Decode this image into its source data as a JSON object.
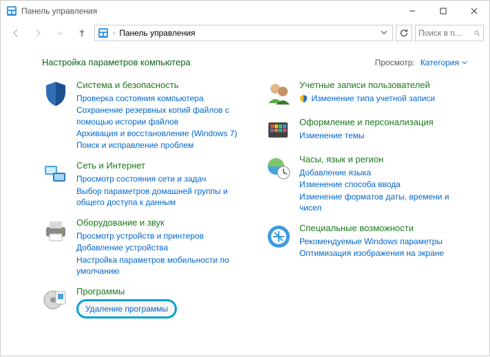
{
  "window": {
    "title": "Панель управления"
  },
  "nav": {
    "breadcrumb": "Панель управления",
    "search_placeholder": "Поиск в п..."
  },
  "header": {
    "page_title": "Настройка параметров компьютера",
    "view_label": "Просмотр:",
    "view_value": "Категория"
  },
  "left": [
    {
      "title": "Система и безопасность",
      "links": [
        "Проверка состояния компьютера",
        "Сохранение резервных копий файлов с помощью истории файлов",
        "Архивация и восстановление (Windows 7)",
        "Поиск и исправление проблем"
      ]
    },
    {
      "title": "Сеть и Интернет",
      "links": [
        "Просмотр состояния сети и задач",
        "Выбор параметров домашней группы и общего доступа к данным"
      ]
    },
    {
      "title": "Оборудование и звук",
      "links": [
        "Просмотр устройств и принтеров",
        "Добавление устройства",
        "Настройка параметров мобильности по умолчанию"
      ]
    },
    {
      "title": "Программы",
      "links": [
        "Удаление программы"
      ]
    }
  ],
  "right": [
    {
      "title": "Учетные записи пользователей",
      "links": [
        "Изменение типа учетной записи"
      ],
      "shield": [
        true
      ]
    },
    {
      "title": "Оформление и персонализация",
      "links": [
        "Изменение темы"
      ]
    },
    {
      "title": "Часы, язык и регион",
      "links": [
        "Добавление языка",
        "Изменение способа ввода",
        "Изменение форматов даты, времени и чисел"
      ]
    },
    {
      "title": "Специальные возможности",
      "links": [
        "Рекомендуемые Windows параметры",
        "Оптимизация изображения на экране"
      ]
    }
  ]
}
